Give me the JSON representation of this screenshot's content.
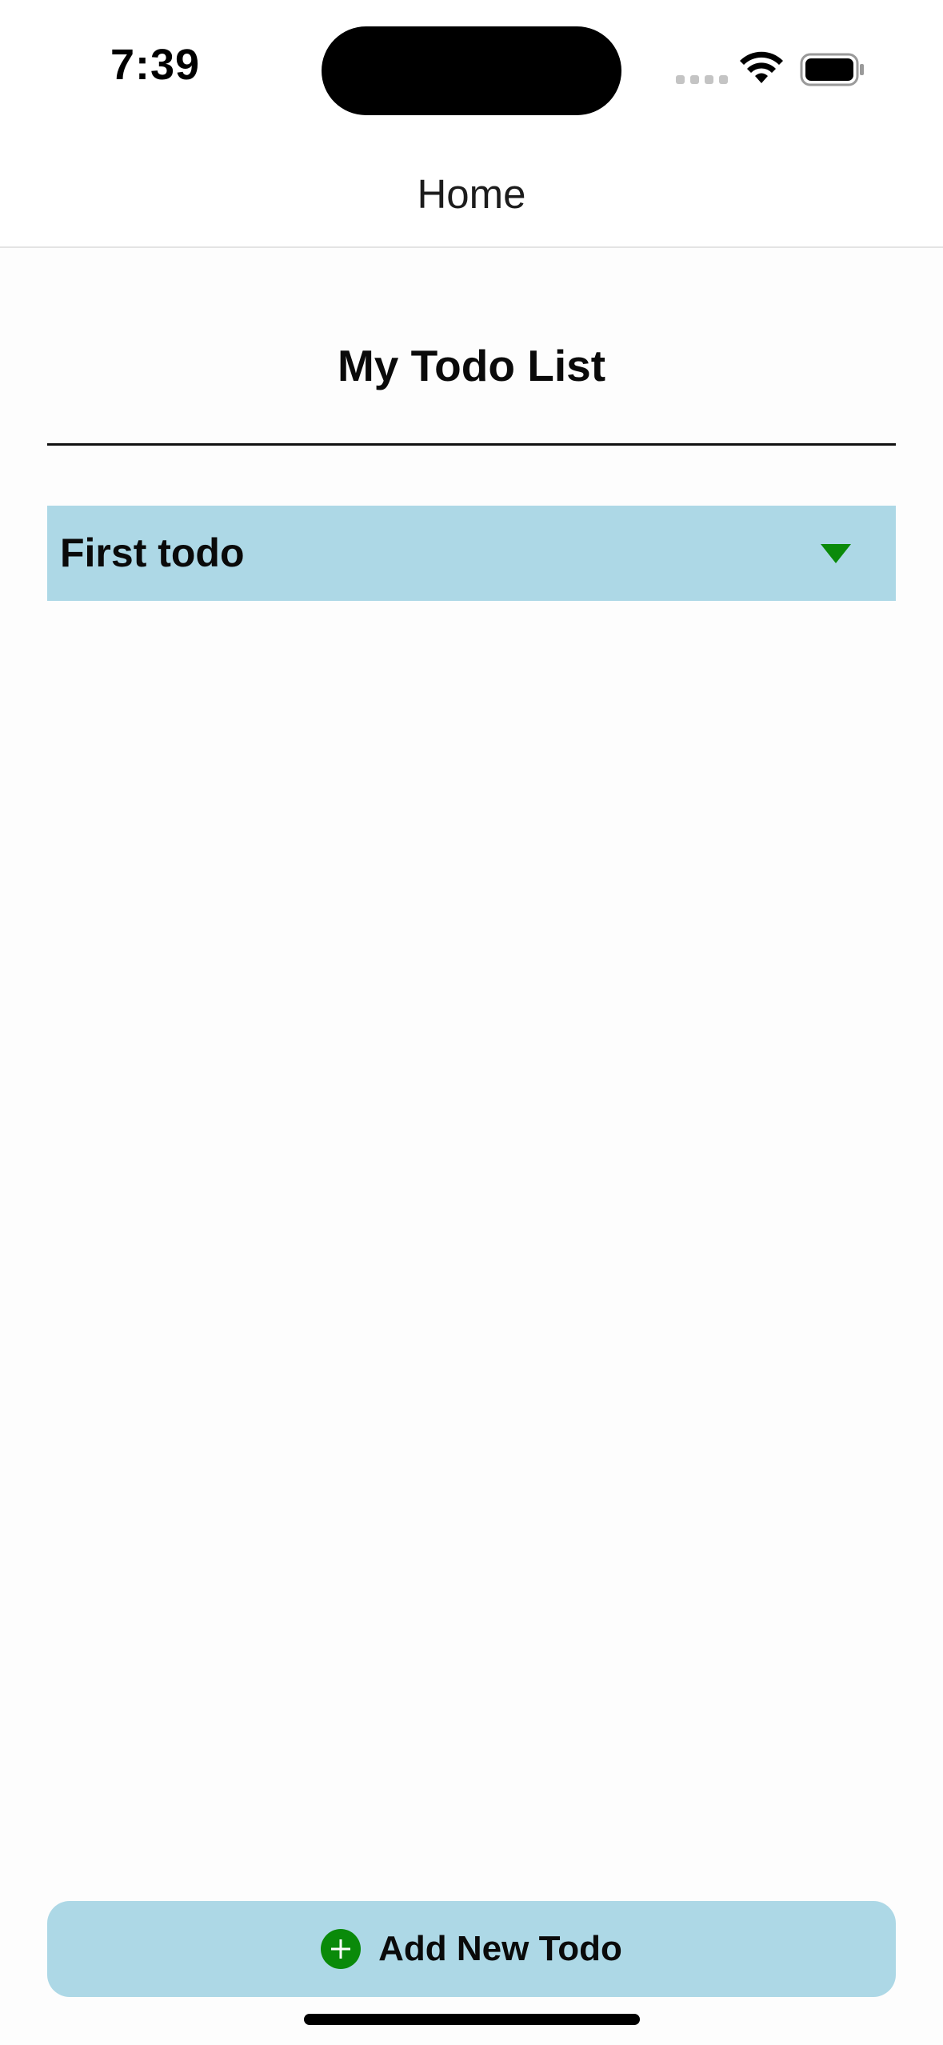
{
  "status_bar": {
    "time": "7:39",
    "icons": [
      "signal-dots-icon",
      "wifi-icon",
      "battery-icon"
    ]
  },
  "nav": {
    "title": "Home"
  },
  "main": {
    "heading": "My Todo List",
    "todos": [
      {
        "label": "First todo",
        "icon": "caret-down-icon"
      }
    ]
  },
  "footer": {
    "add_label": "Add New Todo",
    "add_icon": "plus-circle-icon"
  },
  "colors": {
    "item_background": "#add8e6",
    "accent_green": "#0a8a0a",
    "text": "#0a0a0a"
  }
}
